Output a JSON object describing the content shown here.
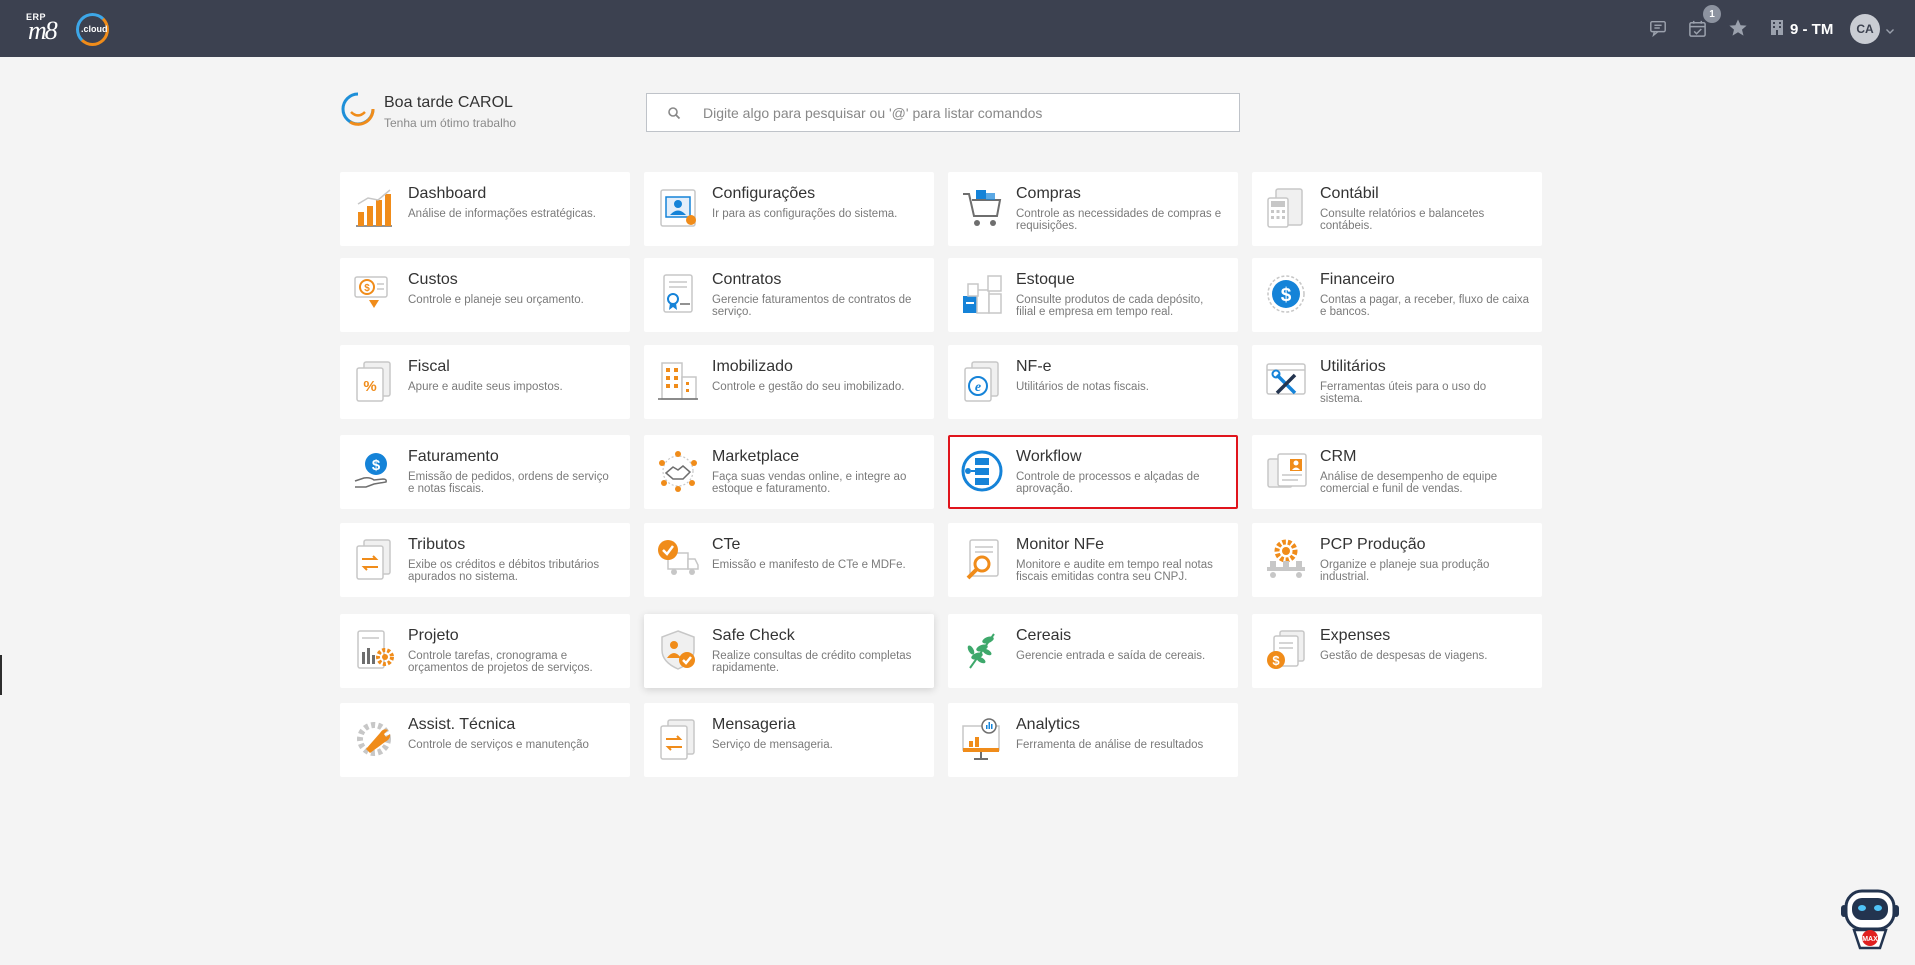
{
  "topbar": {
    "logo": {
      "erp": "ERP",
      "m8": "m8",
      "cloud": ".cloud"
    },
    "notifications_badge": "1",
    "company": "9 - TM",
    "user_initials": "CA",
    "icons": [
      "chat-icon",
      "calendar-check-icon",
      "star-icon",
      "building-icon",
      "chevron-down-icon"
    ]
  },
  "greeting": {
    "title": "Boa tarde CAROL",
    "subtitle": "Tenha um ótimo trabalho"
  },
  "search": {
    "placeholder": "Digite algo para pesquisar ou '@' para listar comandos",
    "value": ""
  },
  "modules": [
    {
      "title": "Dashboard",
      "desc": "Análise de informações estratégicas.",
      "icon": "bar-chart-icon"
    },
    {
      "title": "Configurações",
      "desc": "Ir para as configurações do sistema.",
      "icon": "settings-profile-icon"
    },
    {
      "title": "Compras",
      "desc": "Controle as necessidades de compras e requisições.",
      "icon": "shopping-cart-icon"
    },
    {
      "title": "Contábil",
      "desc": "Consulte relatórios e balancetes contábeis.",
      "icon": "calculator-icon"
    },
    {
      "title": "Custos",
      "desc": "Controle e planeje seu orçamento.",
      "icon": "cost-money-icon"
    },
    {
      "title": "Contratos",
      "desc": "Gerencie faturamentos de contratos de serviço.",
      "icon": "contract-icon"
    },
    {
      "title": "Estoque",
      "desc": "Consulte produtos de cada depósito, filial e empresa em tempo real.",
      "icon": "boxes-icon"
    },
    {
      "title": "Financeiro",
      "desc": "Contas a pagar, a receber, fluxo de caixa e bancos.",
      "icon": "dollar-coin-icon"
    },
    {
      "title": "Fiscal",
      "desc": "Apure e audite seus impostos.",
      "icon": "percent-document-icon"
    },
    {
      "title": "Imobilizado",
      "desc": "Controle e gestão do seu imobilizado.",
      "icon": "building-asset-icon"
    },
    {
      "title": "NF-e",
      "desc": "Utilitários de notas fiscais.",
      "icon": "nfe-document-icon"
    },
    {
      "title": "Utilitários",
      "desc": "Ferramentas úteis para o uso do sistema.",
      "icon": "tools-icon"
    },
    {
      "title": "Faturamento",
      "desc": "Emissão de pedidos, ordens de serviço e notas fiscais.",
      "icon": "billing-hand-icon"
    },
    {
      "title": "Marketplace",
      "desc": "Faça suas vendas online, e integre ao estoque e faturamento.",
      "icon": "handshake-network-icon"
    },
    {
      "title": "Workflow",
      "desc": "Controle de processos e alçadas de aprovação.",
      "icon": "workflow-icon"
    },
    {
      "title": "CRM",
      "desc": "Análise de desempenho de equipe comercial e funil de vendas.",
      "icon": "crm-contacts-icon"
    },
    {
      "title": "Tributos",
      "desc": "Exibe os créditos e débitos tributários apurados no sistema.",
      "icon": "tax-transfer-icon"
    },
    {
      "title": "CTe",
      "desc": "Emissão e manifesto de CTe e MDFe.",
      "icon": "truck-check-icon"
    },
    {
      "title": "Monitor NFe",
      "desc": "Monitore e audite em tempo real notas fiscais emitidas contra seu CNPJ.",
      "icon": "document-search-icon"
    },
    {
      "title": "PCP Produção",
      "desc": "Organize e planeje sua produção industrial.",
      "icon": "production-gear-icon"
    },
    {
      "title": "Projeto",
      "desc": "Controle tarefas, cronograma e orçamentos de projetos de serviços.",
      "icon": "project-gear-icon"
    },
    {
      "title": "Safe Check",
      "desc": "Realize consultas de crédito completas rapidamente.",
      "icon": "shield-check-icon"
    },
    {
      "title": "Cereais",
      "desc": "Gerencie entrada e saída de cereais.",
      "icon": "wheat-icon"
    },
    {
      "title": "Expenses",
      "desc": "Gestão de despesas de viagens.",
      "icon": "expenses-icon"
    },
    {
      "title": "Assist. Técnica",
      "desc": "Controle de serviços e manutenção",
      "icon": "wrench-gear-icon"
    },
    {
      "title": "Mensageria",
      "desc": "Serviço de mensageria.",
      "icon": "message-transfer-icon"
    },
    {
      "title": "Analytics",
      "desc": "Ferramenta de análise de resultados",
      "icon": "analytics-screen-icon"
    }
  ],
  "colors": {
    "topbar": "#3c4150",
    "accent_orange": "#f08c1a",
    "accent_blue": "#1583d8",
    "highlight_border": "#e0141c"
  },
  "assistant": {
    "label": "MAX"
  }
}
